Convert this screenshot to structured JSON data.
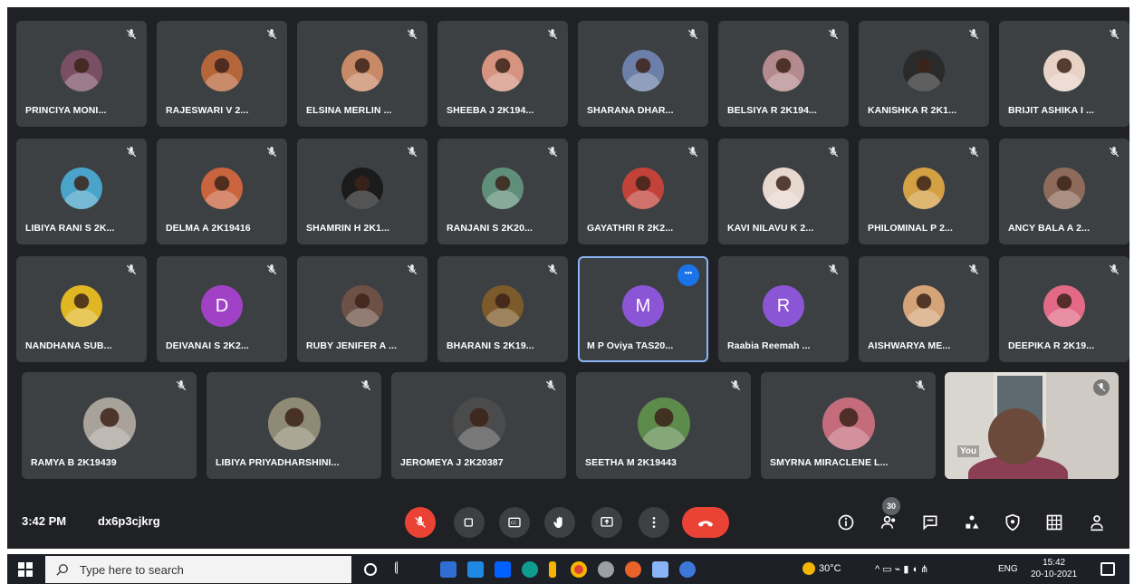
{
  "participants": [
    {
      "name": "PRINCIYA MONI...",
      "avatar_color": "#7a4f66",
      "kind": "photo"
    },
    {
      "name": "RAJESWARI V 2...",
      "avatar_color": "#b5653a",
      "kind": "photo"
    },
    {
      "name": "ELSINA MERLIN ...",
      "avatar_color": "#c88a66",
      "kind": "photo"
    },
    {
      "name": "SHEEBA J 2K194...",
      "avatar_color": "#d59380",
      "kind": "photo"
    },
    {
      "name": "SHARANA DHAR...",
      "avatar_color": "#6c7fa8",
      "kind": "photo"
    },
    {
      "name": "BELSIYA R 2K194...",
      "avatar_color": "#b58a8e",
      "kind": "photo"
    },
    {
      "name": "KANISHKA R 2K1...",
      "avatar_color": "#2a2a2a",
      "kind": "photo"
    },
    {
      "name": "BRIJIT ASHIKA I ...",
      "avatar_color": "#e8d2c6",
      "kind": "photo"
    },
    {
      "name": "LIBIYA RANI S 2K...",
      "avatar_color": "#4aa3c8",
      "kind": "photo"
    },
    {
      "name": "DELMA A 2K19416",
      "avatar_color": "#c9643f",
      "kind": "photo"
    },
    {
      "name": "SHAMRIN H 2K1...",
      "avatar_color": "#1b1b1b",
      "kind": "photo"
    },
    {
      "name": "RANJANI S 2K20...",
      "avatar_color": "#5f8f7a",
      "kind": "photo"
    },
    {
      "name": "GAYATHRI R 2K2...",
      "avatar_color": "#c2423a",
      "kind": "photo"
    },
    {
      "name": "KAVI NILAVU K 2...",
      "avatar_color": "#e7d7cf",
      "kind": "photo"
    },
    {
      "name": "PHILOMINAL P 2...",
      "avatar_color": "#d3a044",
      "kind": "photo"
    },
    {
      "name": "ANCY BALA A 2...",
      "avatar_color": "#8d6a5a",
      "kind": "photo"
    },
    {
      "name": "NANDHANA SUB...",
      "avatar_color": "#e0b623",
      "kind": "photo"
    },
    {
      "name": "DEIVANAI S 2K2...",
      "avatar_color": "#a142c6",
      "kind": "initial",
      "initial": "D"
    },
    {
      "name": "RUBY JENIFER A ...",
      "avatar_color": "#6e5146",
      "kind": "photo"
    },
    {
      "name": "BHARANI S 2K19...",
      "avatar_color": "#7d5a2a",
      "kind": "photo"
    },
    {
      "name": "M P Oviya TAS20...",
      "avatar_color": "#8b55d6",
      "kind": "initial",
      "initial": "M",
      "highlight": true
    },
    {
      "name": "Raabia Reemah ...",
      "avatar_color": "#8b55d6",
      "kind": "initial",
      "initial": "R"
    },
    {
      "name": "AISHWARYA ME...",
      "avatar_color": "#d4a478",
      "kind": "photo"
    },
    {
      "name": "DEEPIKA R 2K19...",
      "avatar_color": "#e26a86",
      "kind": "photo"
    },
    {
      "name": "RAMYA B 2K19439",
      "avatar_color": "#a9a29a",
      "kind": "photo"
    },
    {
      "name": "LIBIYA PRIYADHARSHINI...",
      "avatar_color": "#8f8a74",
      "kind": "photo"
    },
    {
      "name": "JEROMEYA J 2K20387",
      "avatar_color": "#4b4b4b",
      "kind": "photo"
    },
    {
      "name": "SEETHA M 2K19443",
      "avatar_color": "#5d8b4c",
      "kind": "photo"
    },
    {
      "name": "SMYRNA MIRACLENE L...",
      "avatar_color": "#c46c7c",
      "kind": "photo"
    }
  ],
  "self_view": {
    "label": "You"
  },
  "bottom_bar": {
    "time": "3:42 PM",
    "meeting_code": "dx6p3cjkrg",
    "participant_count": "30"
  },
  "taskbar": {
    "search_placeholder": "Type here to search",
    "weather": "30°C",
    "language": "ENG",
    "clock_time": "15:42",
    "clock_date": "20-10-2021"
  },
  "colors": {
    "meet_bg": "#202124",
    "tile_bg": "#3c4043",
    "red": "#ea4335",
    "taskbar_bg": "#1d2027"
  }
}
